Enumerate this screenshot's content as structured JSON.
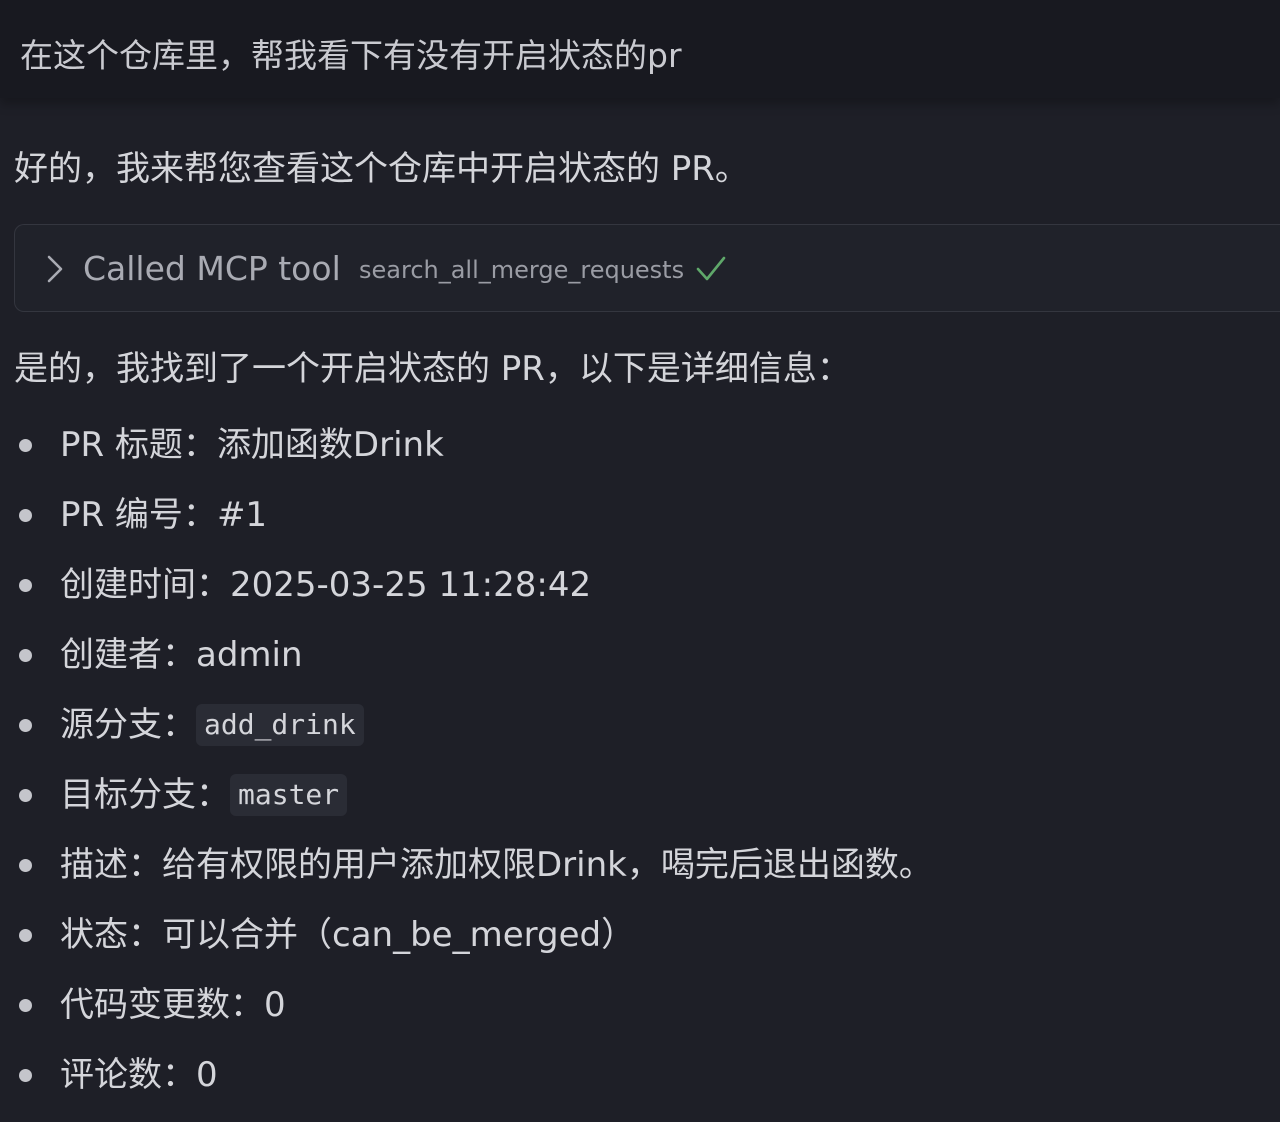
{
  "user_message": {
    "text": "在这个仓库里，帮我看下有没有开启状态的pr"
  },
  "assistant": {
    "intro": "好的，我来帮您查看这个仓库中开启状态的 PR。",
    "tool_call": {
      "title": "Called MCP tool",
      "tool_name": "search_all_merge_requests",
      "status": "success"
    },
    "summary": "是的，我找到了一个开启状态的 PR，以下是详细信息：",
    "details": [
      {
        "label": "PR 标题：",
        "value": "添加函数Drink"
      },
      {
        "label": "PR 编号：",
        "value": "#1"
      },
      {
        "label": "创建时间：",
        "value": "2025-03-25 11:28:42"
      },
      {
        "label": "创建者：",
        "value": "admin"
      },
      {
        "label": "源分支：",
        "code": "add_drink"
      },
      {
        "label": "目标分支：",
        "code": "master"
      },
      {
        "label": "描述：",
        "value": "给有权限的用户添加权限Drink，喝完后退出函数。"
      },
      {
        "label": "状态：",
        "value": "可以合并（can_be_merged）"
      },
      {
        "label": "代码变更数：",
        "value": "0"
      },
      {
        "label": "评论数：",
        "value": "0"
      }
    ]
  },
  "colors": {
    "background": "#1e1f27",
    "user_bar": "#181920",
    "check": "#5fa86a",
    "code_bg": "#2a2c35"
  }
}
